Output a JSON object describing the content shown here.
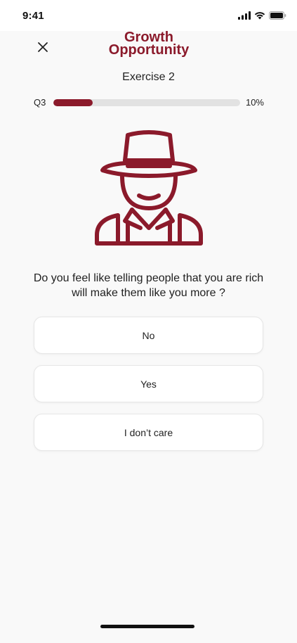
{
  "status_bar": {
    "time": "9:41",
    "icons": [
      "signal-icon",
      "wifi-icon",
      "battery-icon"
    ]
  },
  "header": {
    "close_icon": "close-icon",
    "title_line1": "Growth",
    "title_line2": "Opportunity",
    "subtitle": "Exercise 2"
  },
  "progress": {
    "question_label": "Q3",
    "percent_label": "10%",
    "fill_fraction": 0.21
  },
  "illustration": {
    "icon": "farmer-avatar-icon"
  },
  "question": {
    "text": "Do you feel like telling people that you are rich will make them like you more ?"
  },
  "options": [
    {
      "label": "No"
    },
    {
      "label": "Yes"
    },
    {
      "label": "I don’t care"
    }
  ],
  "colors": {
    "accent": "#8b1a2b",
    "background": "#f9f9f9",
    "track": "#e2e2e2"
  }
}
